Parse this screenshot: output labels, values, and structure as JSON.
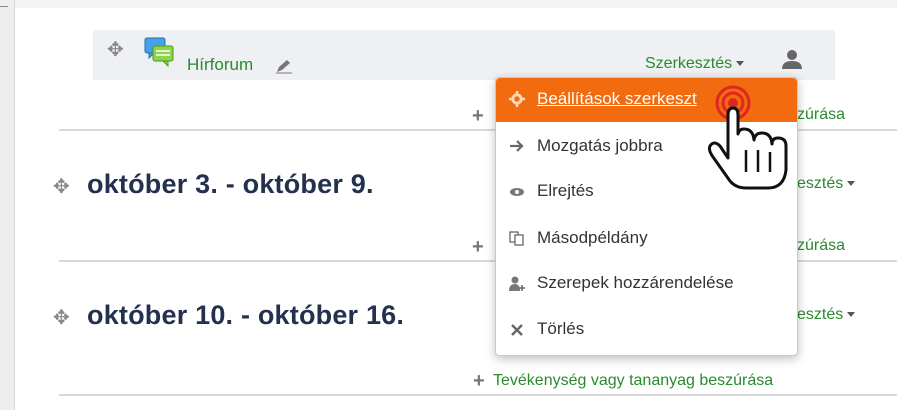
{
  "activity": {
    "name": "Hírforum",
    "edit_menu": "Szerkesztés"
  },
  "sections": [
    {
      "title": "október 3. - október 9.",
      "edit": "esztés"
    },
    {
      "title": "október 10. - október 16.",
      "edit": "esztés"
    }
  ],
  "add_activity": {
    "partial_1": "zúrása",
    "partial_2": "zúrása",
    "full": "Tevékenység vagy tananyag beszúrása"
  },
  "dropdown": {
    "items": [
      {
        "label": "Beállítások szerkeszt",
        "icon": "gear-icon"
      },
      {
        "label": "Mozgatás jobbra",
        "icon": "arrow-right-icon"
      },
      {
        "label": "Elrejtés",
        "icon": "eye-icon"
      },
      {
        "label": "Másodpéldány",
        "icon": "copy-icon"
      },
      {
        "label": "Szerepek hozzárendelése",
        "icon": "assign-roles-icon"
      },
      {
        "label": "Törlés",
        "icon": "delete-icon"
      }
    ]
  },
  "colors": {
    "accent": "#f26b0f",
    "link": "#2a8a2e",
    "title": "#23314f"
  }
}
